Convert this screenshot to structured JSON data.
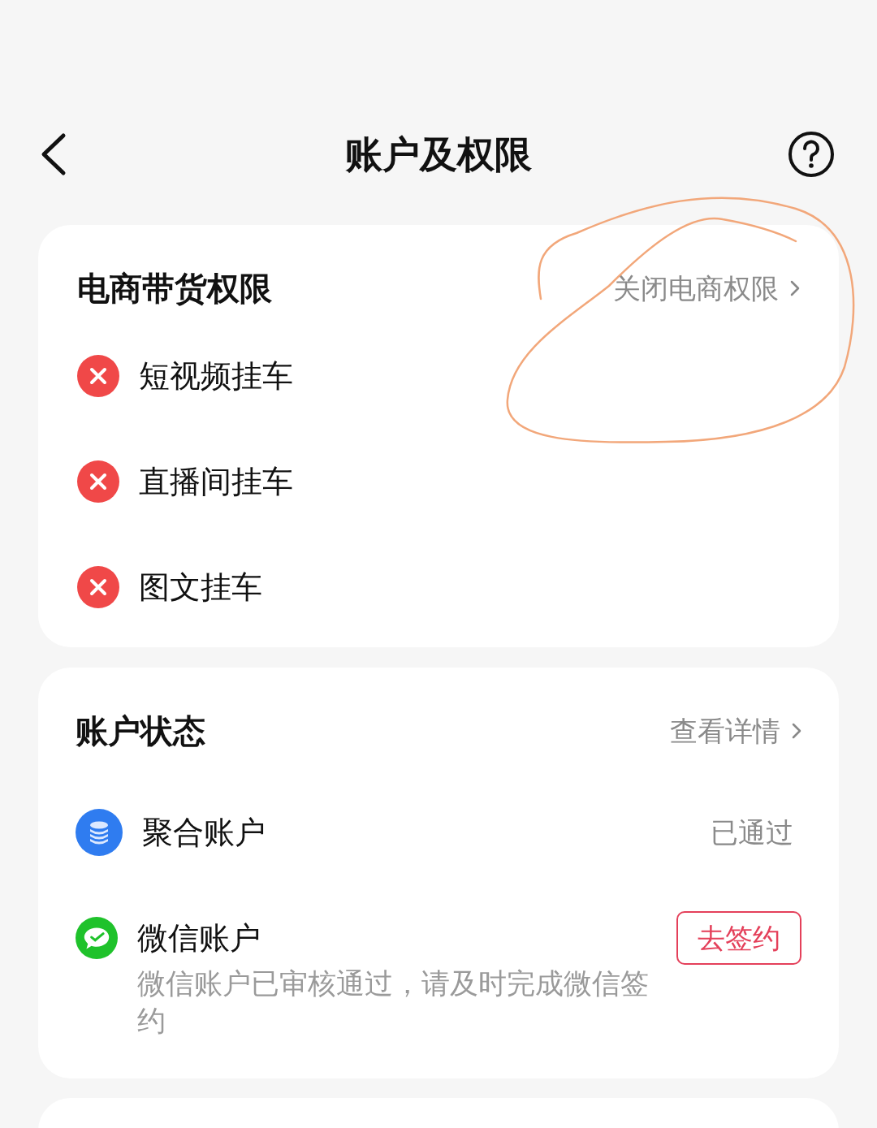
{
  "header": {
    "title": "账户及权限"
  },
  "commerce": {
    "title": "电商带货权限",
    "link": "关闭电商权限",
    "items": [
      {
        "label": "短视频挂车",
        "enabled": false
      },
      {
        "label": "直播间挂车",
        "enabled": false
      },
      {
        "label": "图文挂车",
        "enabled": false
      }
    ]
  },
  "account": {
    "title": "账户状态",
    "link": "查看详情",
    "rows": [
      {
        "kind": "status",
        "label": "聚合账户",
        "status": "已通过"
      },
      {
        "kind": "action",
        "label": "微信账户",
        "note": "微信账户已审核通过，请及时完成微信签约",
        "button": "去签约"
      }
    ]
  }
}
